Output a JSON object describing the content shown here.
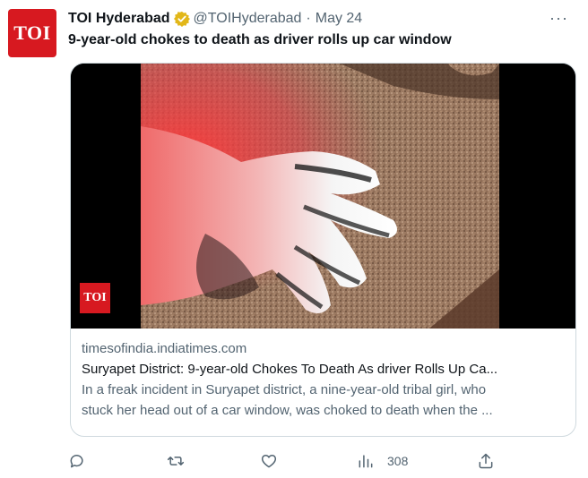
{
  "account": {
    "name": "TOI Hyderabad",
    "handle": "@TOIHyderabad",
    "separator": "·",
    "date": "May 24",
    "avatar_text": "TOI",
    "verified_icon": "gold-check-badge-icon"
  },
  "tweet": {
    "text": "9-year-old chokes to death as driver rolls up car window",
    "more_label": "···"
  },
  "card": {
    "media_badge": "TOI",
    "domain": "timesofindia.indiatimes.com",
    "title": "Suryapet District: 9-year-old Chokes To Death As driver Rolls Up Ca...",
    "description_line1": "In a freak incident in Suryapet district, a nine-year-old tribal girl, who",
    "description_line2": "stuck her head out of a car window, was choked to death when the ..."
  },
  "actions": {
    "reply_icon": "reply-icon",
    "retweet_icon": "retweet-icon",
    "like_icon": "heart-icon",
    "views_icon": "views-icon",
    "views_count": "308",
    "share_icon": "share-icon"
  },
  "colors": {
    "toi_red": "#d71920",
    "text_primary": "#0f1419",
    "text_secondary": "#536471",
    "border": "#cfd9de",
    "verified_gold": "#e2b719"
  }
}
